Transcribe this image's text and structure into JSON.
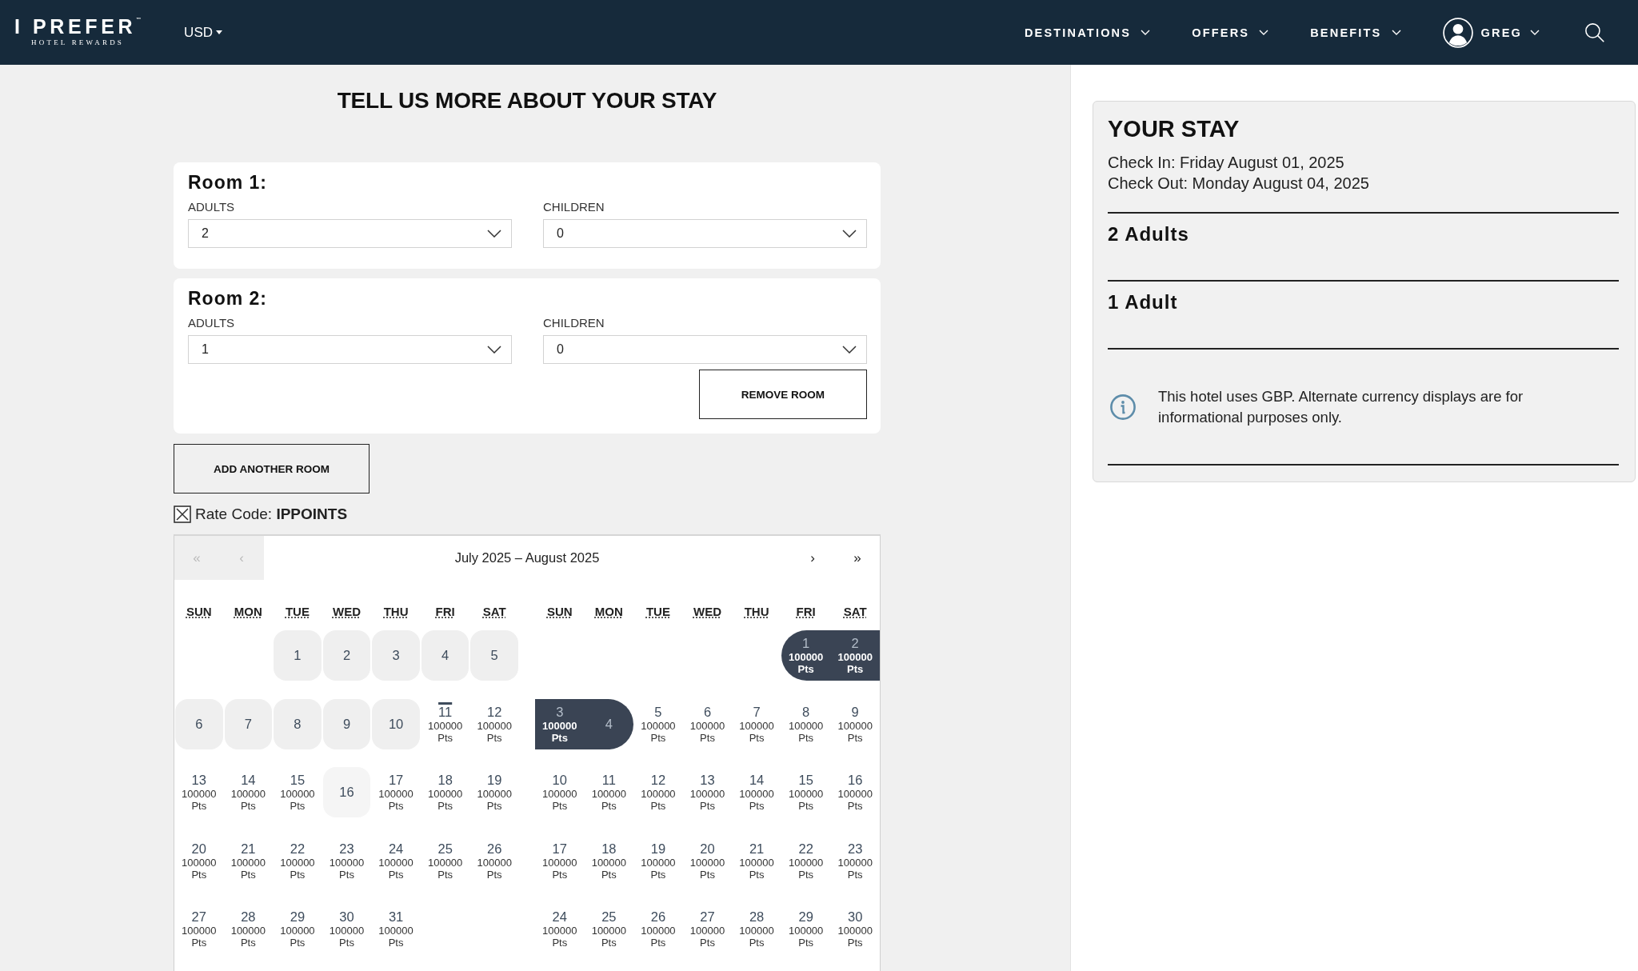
{
  "header": {
    "logo": {
      "title": "I PREFER$^{™}$",
      "subtitle": "HOTEL REWARDS"
    },
    "currency": "USD",
    "nav": [
      {
        "label": "DESTINATIONS"
      },
      {
        "label": "OFFERS"
      },
      {
        "label": "BENEFITS"
      }
    ],
    "user": {
      "name": "GREG"
    }
  },
  "booking": {
    "title": "TELL US MORE ABOUT YOUR STAY",
    "rooms": [
      {
        "title": "Room 1:",
        "fields": [
          {
            "label": "ADULTS",
            "value": "2"
          },
          {
            "label": "CHILDREN",
            "value": "0"
          }
        ]
      },
      {
        "title": "Room 2:",
        "fields": [
          {
            "label": "ADULTS",
            "value": "1"
          },
          {
            "label": "CHILDREN",
            "value": "0"
          }
        ],
        "remove_button": "REMOVE ROOM"
      }
    ],
    "add_room_button": "ADD ANOTHER ROOM",
    "rate_code": {
      "checked": true,
      "text": "Rate Code: **IPPOINTS**"
    }
  },
  "calendar": {
    "title": "July 2025 – August 2025",
    "nav_back": [
      {
        "label": "«",
        "disabled": true
      },
      {
        "label": "‹",
        "disabled": true
      }
    ],
    "nav_forward": [
      {
        "label": "›",
        "disabled": false
      },
      {
        "label": "»",
        "disabled": false
      }
    ],
    "months": [
      {
        "weekdays": [
          "SUN",
          "MON",
          "TUE",
          "WED",
          "THU",
          "FRI",
          "SAT"
        ],
        "weeks": [
          [
            {
              "kind": "blank"
            },
            {
              "kind": "blank"
            },
            {
              "day": "1",
              "kind": "past",
              "selected": false
            },
            {
              "day": "2",
              "kind": "past",
              "selected": false
            },
            {
              "day": "3",
              "kind": "past",
              "selected": false
            },
            {
              "day": "4",
              "kind": "past",
              "selected": false
            },
            {
              "day": "5",
              "kind": "past",
              "selected": false
            }
          ],
          [
            {
              "day": "6",
              "kind": "past",
              "selected": false
            },
            {
              "day": "7",
              "kind": "past",
              "selected": false
            },
            {
              "day": "8",
              "kind": "past",
              "selected": false
            },
            {
              "day": "9",
              "kind": "past",
              "selected": false
            },
            {
              "day": "10",
              "kind": "past",
              "selected": false
            },
            {
              "day": "11",
              "kind": "today",
              "points": "100000 Pts",
              "selected": false
            },
            {
              "day": "12",
              "kind": "open",
              "points": "100000 Pts",
              "selected": false
            }
          ],
          [
            {
              "day": "13",
              "kind": "open",
              "points": "100000 Pts",
              "selected": false
            },
            {
              "day": "14",
              "kind": "open",
              "points": "100000 Pts",
              "selected": false
            },
            {
              "day": "15",
              "kind": "open",
              "points": "100000 Pts",
              "selected": false
            },
            {
              "day": "16",
              "kind": "unavailable",
              "selected": false
            },
            {
              "day": "17",
              "kind": "open",
              "points": "100000 Pts",
              "selected": false
            },
            {
              "day": "18",
              "kind": "open",
              "points": "100000 Pts",
              "selected": false
            },
            {
              "day": "19",
              "kind": "open",
              "points": "100000 Pts",
              "selected": false
            }
          ],
          [
            {
              "day": "20",
              "kind": "open",
              "points": "100000 Pts",
              "selected": false
            },
            {
              "day": "21",
              "kind": "open",
              "points": "100000 Pts",
              "selected": false
            },
            {
              "day": "22",
              "kind": "open",
              "points": "100000 Pts",
              "selected": false
            },
            {
              "day": "23",
              "kind": "open",
              "points": "100000 Pts",
              "selected": false
            },
            {
              "day": "24",
              "kind": "open",
              "points": "100000 Pts",
              "selected": false
            },
            {
              "day": "25",
              "kind": "open",
              "points": "100000 Pts",
              "selected": false
            },
            {
              "day": "26",
              "kind": "open",
              "points": "100000 Pts",
              "selected": false
            }
          ],
          [
            {
              "day": "27",
              "kind": "open",
              "points": "100000 Pts",
              "selected": false
            },
            {
              "day": "28",
              "kind": "open",
              "points": "100000 Pts",
              "selected": false
            },
            {
              "day": "29",
              "kind": "open",
              "points": "100000 Pts",
              "selected": false
            },
            {
              "day": "30",
              "kind": "open",
              "points": "100000 Pts",
              "selected": false
            },
            {
              "day": "31",
              "kind": "open",
              "points": "100000 Pts",
              "selected": false
            }
          ]
        ]
      },
      {
        "weekdays": [
          "SUN",
          "MON",
          "TUE",
          "WED",
          "THU",
          "FRI",
          "SAT"
        ],
        "weeks": [
          [
            {
              "kind": "blank"
            },
            {
              "kind": "blank"
            },
            {
              "kind": "blank"
            },
            {
              "kind": "blank"
            },
            {
              "kind": "blank"
            },
            {
              "day": "1",
              "kind": "open",
              "points": "100000 Pts",
              "selected": true
            },
            {
              "day": "2",
              "kind": "open",
              "points": "100000 Pts",
              "selected": true
            }
          ],
          [
            {
              "day": "3",
              "kind": "open",
              "points": "100000 Pts",
              "selected": true
            },
            {
              "day": "4",
              "kind": "open",
              "selected": true
            },
            {
              "day": "5",
              "kind": "open",
              "points": "100000 Pts",
              "selected": false
            },
            {
              "day": "6",
              "kind": "open",
              "points": "100000 Pts",
              "selected": false
            },
            {
              "day": "7",
              "kind": "open",
              "points": "100000 Pts",
              "selected": false
            },
            {
              "day": "8",
              "kind": "open",
              "points": "100000 Pts",
              "selected": false
            },
            {
              "day": "9",
              "kind": "open",
              "points": "100000 Pts",
              "selected": false
            }
          ],
          [
            {
              "day": "10",
              "kind": "open",
              "points": "100000 Pts",
              "selected": false
            },
            {
              "day": "11",
              "kind": "open",
              "points": "100000 Pts",
              "selected": false
            },
            {
              "day": "12",
              "kind": "open",
              "points": "100000 Pts",
              "selected": false
            },
            {
              "day": "13",
              "kind": "open",
              "points": "100000 Pts",
              "selected": false
            },
            {
              "day": "14",
              "kind": "open",
              "points": "100000 Pts",
              "selected": false
            },
            {
              "day": "15",
              "kind": "open",
              "points": "100000 Pts",
              "selected": false
            },
            {
              "day": "16",
              "kind": "open",
              "points": "100000 Pts",
              "selected": false
            }
          ],
          [
            {
              "day": "17",
              "kind": "open",
              "points": "100000 Pts",
              "selected": false
            },
            {
              "day": "18",
              "kind": "open",
              "points": "100000 Pts",
              "selected": false
            },
            {
              "day": "19",
              "kind": "open",
              "points": "100000 Pts",
              "selected": false
            },
            {
              "day": "20",
              "kind": "open",
              "points": "100000 Pts",
              "selected": false
            },
            {
              "day": "21",
              "kind": "open",
              "points": "100000 Pts",
              "selected": false
            },
            {
              "day": "22",
              "kind": "open",
              "points": "100000 Pts",
              "selected": false
            },
            {
              "day": "23",
              "kind": "open",
              "points": "100000 Pts",
              "selected": false
            }
          ],
          [
            {
              "day": "24",
              "kind": "open",
              "points": "100000 Pts",
              "selected": false
            },
            {
              "day": "25",
              "kind": "open",
              "points": "100000 Pts",
              "selected": false
            },
            {
              "day": "26",
              "kind": "open",
              "points": "100000 Pts",
              "selected": false
            },
            {
              "day": "27",
              "kind": "open",
              "points": "100000 Pts",
              "selected": false
            },
            {
              "day": "28",
              "kind": "open",
              "points": "100000 Pts",
              "selected": false
            },
            {
              "day": "29",
              "kind": "open",
              "points": "100000 Pts",
              "selected": false
            },
            {
              "day": "30",
              "kind": "open",
              "points": "100000 Pts",
              "selected": false
            }
          ]
        ]
      }
    ]
  },
  "summary": {
    "title": "YOUR STAY",
    "dates": [
      "Check In: Friday August 01, 2025",
      "Check Out: Monday August 04, 2025"
    ],
    "rooms": [
      "2 Adults",
      "1 Adult"
    ],
    "notice": "This hotel uses GBP. Alternate currency displays are for informational purposes only."
  }
}
